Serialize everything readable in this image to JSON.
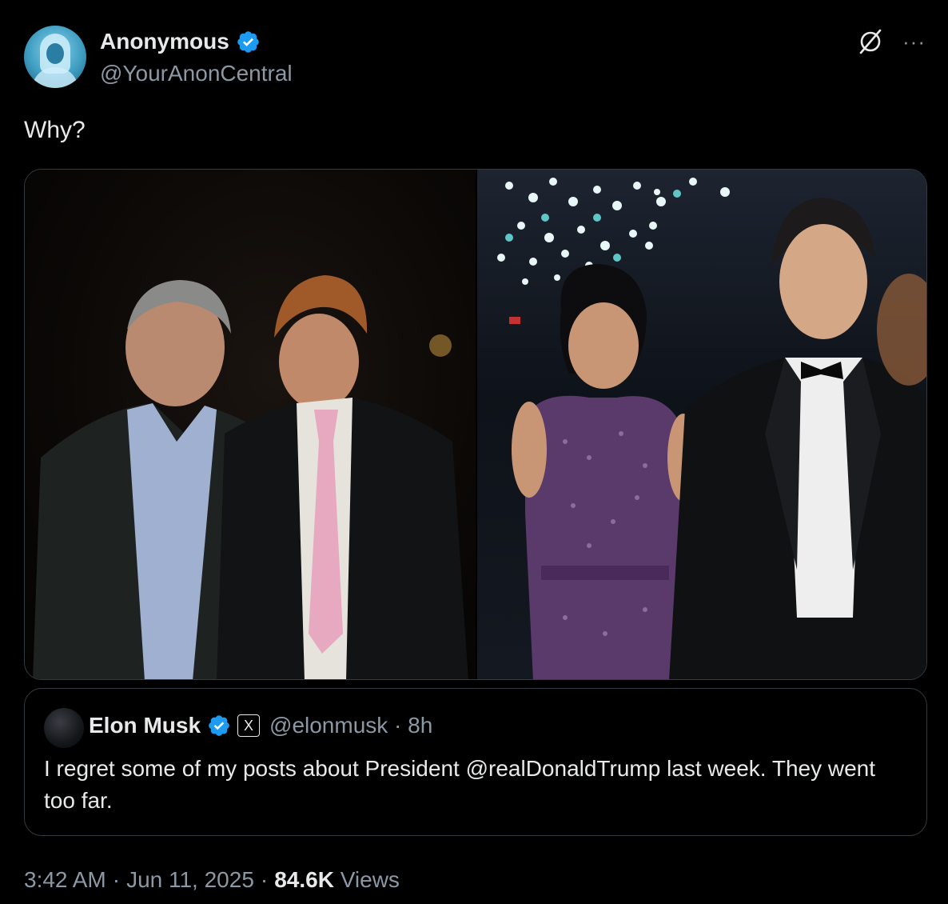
{
  "author": {
    "display_name": "Anonymous",
    "handle": "@YourAnonCentral",
    "verified_color": "#1d9bf0"
  },
  "icons": {
    "grok": "grok-icon",
    "more": "more-icon"
  },
  "tweet": {
    "text": "Why?"
  },
  "media": {
    "images": [
      "left-photo",
      "right-photo"
    ]
  },
  "quoted": {
    "display_name": "Elon Musk",
    "affiliate_badge": "X",
    "handle_time": "@elonmusk · 8h",
    "text": "I regret some of my posts about President @realDonaldTrump last week. They went too far."
  },
  "meta": {
    "time": "3:42 AM",
    "sep1": "·",
    "date": "Jun 11, 2025",
    "sep2": "·",
    "views_count": "84.6K",
    "views_label": "Views"
  },
  "more_glyph": "···"
}
